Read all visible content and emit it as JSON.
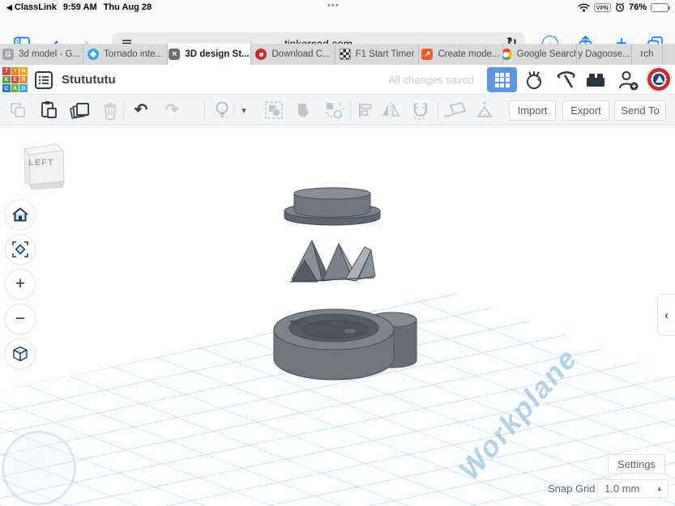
{
  "status_bar": {
    "back_to_app": "ClassLink",
    "time": "9:59 AM",
    "date": "Thu Aug 28",
    "vpn_label": "VPN",
    "battery_percent": "76%"
  },
  "browser": {
    "url": "tinkercad.com",
    "tabs": [
      {
        "label": "3d model - G...",
        "fav_text": "G"
      },
      {
        "label": "Tornado inte...",
        "fav_text": ""
      },
      {
        "label": "3D design St...",
        "close_glyph": "×"
      },
      {
        "label": "Download C...",
        "fav_text": ""
      },
      {
        "label": "F1 Start Timer",
        "fav_text": ""
      },
      {
        "label": "Create mode...",
        "fav_text": "↗"
      },
      {
        "label": "Google Search",
        "fav_text": "G"
      },
      {
        "label": "y Dagoose..."
      },
      {
        "label": "rch"
      }
    ]
  },
  "header": {
    "logo_letters": [
      "T",
      "I",
      "N",
      "K",
      "E",
      "R",
      "C",
      "A",
      "D"
    ],
    "title": "Stutututu",
    "save_status": "All changes saved"
  },
  "toolbar": {
    "import_label": "Import",
    "export_label": "Export",
    "send_to_label": "Send To"
  },
  "viewport": {
    "view_cube_face": "LEFT",
    "workplane_label": "Workplane"
  },
  "footer": {
    "settings_label": "Settings",
    "snap_grid_label": "Snap Grid",
    "snap_grid_value": "1.0 mm"
  },
  "icons": {
    "back_triangle": "◀",
    "window_dots": "•••",
    "chevron_back": "‹",
    "chevron_forward": "›",
    "reload": "↻",
    "download_arrow": "↓",
    "new_tab_plus": "+",
    "undo": "↶",
    "redo": "↷",
    "caret_down": "▾",
    "caret_up": "▴",
    "zoom_in": "+",
    "zoom_out": "−",
    "panel_chevron": "‹"
  },
  "colors": {
    "safari_accent": "#0a7cff",
    "tinkercad_blue": "#5b97e0",
    "workplane_line": "#96c3e0",
    "shape_gray": "#70767c",
    "shape_outline": "#3c4e60"
  }
}
